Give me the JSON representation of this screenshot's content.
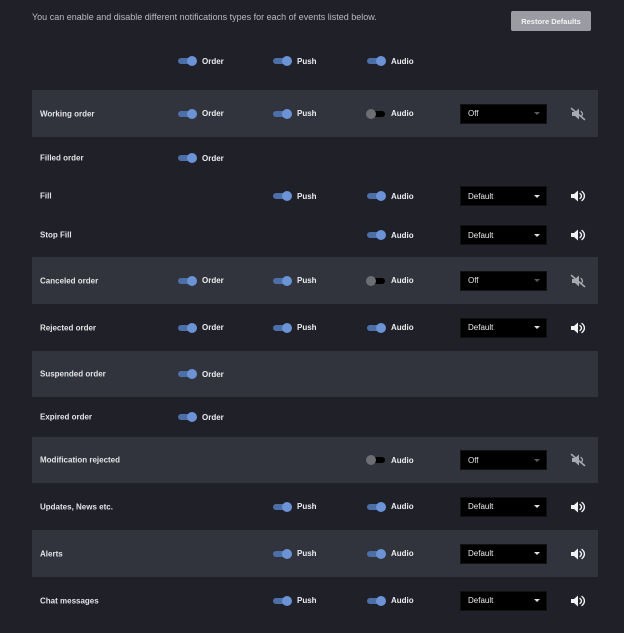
{
  "intro_text": "You can enable and disable different notifications types for each of events listed below.",
  "restore_label": "Restore Defaults",
  "labels": {
    "order": "Order",
    "push": "Push",
    "audio": "Audio"
  },
  "header": {
    "order": true,
    "push": true,
    "audio": true
  },
  "rows": [
    {
      "label": "Working order",
      "order": true,
      "push": true,
      "audio": false,
      "sound": "Off",
      "muted": true
    },
    {
      "label": "Filled order",
      "order": true
    },
    {
      "label": "Fill",
      "push": true,
      "audio": true,
      "sound": "Default",
      "muted": false
    },
    {
      "label": "Stop Fill",
      "audio": true,
      "sound": "Default",
      "muted": false
    },
    {
      "label": "Canceled order",
      "order": true,
      "push": true,
      "audio": false,
      "sound": "Off",
      "muted": true
    },
    {
      "label": "Rejected order",
      "order": true,
      "push": true,
      "audio": true,
      "sound": "Default",
      "muted": false
    },
    {
      "label": "Suspended order",
      "order": true
    },
    {
      "label": "Expired order",
      "order": true
    },
    {
      "label": "Modification rejected",
      "audio": false,
      "sound": "Off",
      "muted": true
    },
    {
      "label": "Updates, News etc.",
      "push": true,
      "audio": true,
      "sound": "Default",
      "muted": false
    },
    {
      "label": "Alerts",
      "push": true,
      "audio": true,
      "sound": "Default",
      "muted": false
    },
    {
      "label": "Chat messages",
      "push": true,
      "audio": true,
      "sound": "Default",
      "muted": false
    }
  ]
}
